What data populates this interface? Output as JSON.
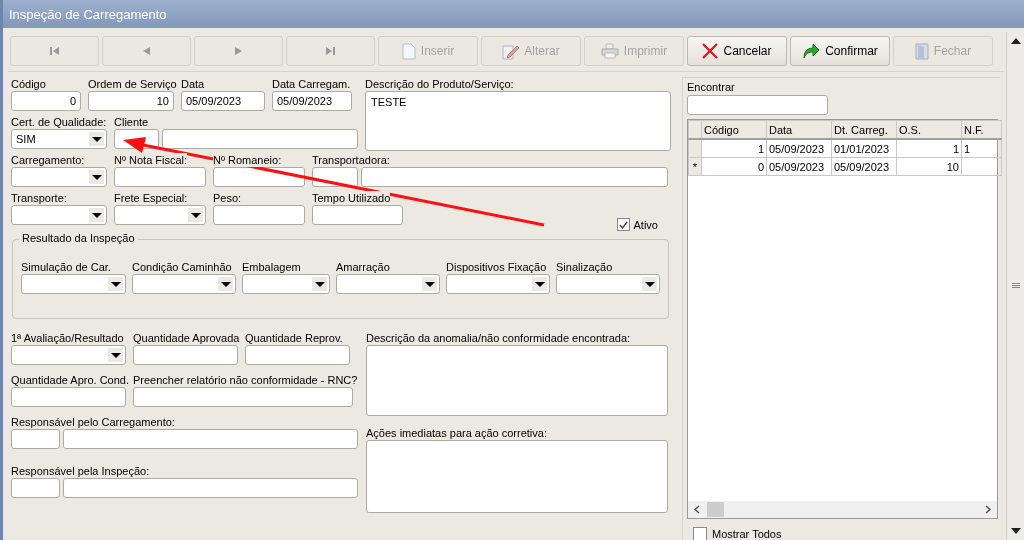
{
  "window": {
    "title": "Inspeção de Carregamento"
  },
  "toolbar": {
    "nav_buttons": [
      {
        "kind": "first",
        "disabled": true
      },
      {
        "kind": "prev",
        "disabled": true
      },
      {
        "kind": "next",
        "disabled": true
      },
      {
        "kind": "last",
        "disabled": true
      }
    ],
    "buttons": [
      {
        "kind": "insert",
        "label": "Inserir",
        "disabled": true
      },
      {
        "kind": "edit",
        "label": "Alterar",
        "disabled": true
      },
      {
        "kind": "print",
        "label": "Imprimir",
        "disabled": true
      },
      {
        "kind": "cancel",
        "label": "Cancelar",
        "disabled": false
      },
      {
        "kind": "confirm",
        "label": "Confirmar",
        "disabled": false
      },
      {
        "kind": "close",
        "label": "Fechar",
        "disabled": true
      }
    ]
  },
  "form": {
    "top_rows": [
      [
        {
          "kind": "number",
          "label": "Código",
          "value": "0"
        },
        {
          "kind": "number",
          "label": "Ordem de Serviço",
          "value": "10"
        },
        {
          "kind": "text",
          "label": "Data",
          "value": "05/09/2023"
        },
        {
          "kind": "text",
          "label": "Data Carregam.",
          "value": "05/09/2023"
        }
      ],
      [
        {
          "kind": "combo",
          "label": "Cert. de Qualidade:",
          "value": "SIM"
        },
        {
          "kind": "pair",
          "label": "Cliente"
        }
      ]
    ],
    "description": {
      "label": "Descrição do Produto/Serviço:",
      "value": "TESTE"
    },
    "mid_rows": [
      [
        {
          "kind": "combo",
          "label": "Carregamento:"
        },
        {
          "kind": "text",
          "label": "Nº Nota Fiscal:"
        },
        {
          "kind": "text",
          "label": "Nº Romaneio:"
        },
        {
          "kind": "pair",
          "label": "Transportadora:"
        }
      ],
      [
        {
          "kind": "combo",
          "label": "Transporte:"
        },
        {
          "kind": "combo",
          "label": "Frete Especial:"
        },
        {
          "kind": "text",
          "label": "Peso:"
        },
        {
          "kind": "text",
          "label": "Tempo Utilizado"
        }
      ]
    ],
    "active": {
      "label": "Ativo",
      "checked": true
    },
    "inspection_group": {
      "title": "Resultado da Inspeção",
      "fields": [
        {
          "kind": "combo",
          "label": "Simulação de Car."
        },
        {
          "kind": "combo",
          "label": "Condição Caminhão"
        },
        {
          "kind": "combo",
          "label": "Embalagem"
        },
        {
          "kind": "combo",
          "label": "Amarração"
        },
        {
          "kind": "combo",
          "label": "Dispositivos Fixação"
        },
        {
          "kind": "combo",
          "label": "Sinalização"
        }
      ]
    },
    "bottom_rows": [
      [
        {
          "kind": "combo",
          "label": "1ª Avaliação/Resultado"
        },
        {
          "kind": "text",
          "label": "Quantidade Aprovada"
        },
        {
          "kind": "text",
          "label": "Quantidade Reprov."
        }
      ],
      [
        {
          "kind": "text",
          "label": "Quantidade Apro. Cond."
        },
        {
          "kind": "text",
          "label": "Preencher relatório não conformidade - RNC?"
        }
      ],
      [
        {
          "kind": "pair",
          "label": "Responsável pelo Carregamento:"
        }
      ],
      [
        {
          "kind": "pair",
          "label": "Responsável pela Inspeção:"
        }
      ]
    ],
    "text_areas": [
      {
        "label": "Descrição da anomalia/não conformidade encontrada:"
      },
      {
        "label": "Ações imediatas para ação corretiva:"
      }
    ]
  },
  "search": {
    "label": "Encontrar"
  },
  "grid": {
    "columns": [
      {
        "label": "Código",
        "kind": "number"
      },
      {
        "label": "Data",
        "kind": "text"
      },
      {
        "label": "Dt. Carreg.",
        "kind": "text"
      },
      {
        "label": "O.S.",
        "kind": "number"
      },
      {
        "label": "N.F.",
        "kind": "text"
      }
    ],
    "rows": [
      {
        "indicator": "",
        "cells": [
          "1",
          "05/09/2023",
          "01/01/2023",
          "1",
          "1"
        ]
      },
      {
        "indicator": "*",
        "cells": [
          "0",
          "05/09/2023",
          "05/09/2023",
          "10",
          ""
        ]
      }
    ]
  },
  "show_all": {
    "label": "Mostrar Todos",
    "checked": false
  }
}
